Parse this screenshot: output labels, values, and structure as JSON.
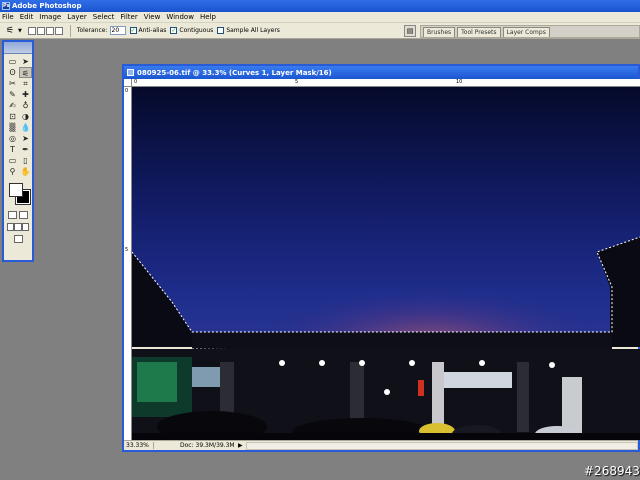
{
  "app": {
    "title": "Adobe Photoshop"
  },
  "menu": [
    "File",
    "Edit",
    "Image",
    "Layer",
    "Select",
    "Filter",
    "View",
    "Window",
    "Help"
  ],
  "options": {
    "tool_icon": "magic-wand-icon",
    "tolerance_label": "Tolerance:",
    "tolerance_value": "20",
    "anti_alias_label": "Anti-alias",
    "anti_alias_checked": true,
    "contiguous_label": "Contiguous",
    "contiguous_checked": true,
    "sample_all_label": "Sample All Layers",
    "sample_all_checked": false
  },
  "palette_well": {
    "tabs": [
      "Brushes",
      "Tool Presets",
      "Layer Comps"
    ]
  },
  "toolbox": {
    "tools": [
      "▭",
      "➤",
      "ʘ",
      "✂",
      "⌗",
      "✎",
      "✚",
      "✍",
      "♁",
      "⊡",
      "◑",
      "▒",
      "💧",
      "◎",
      "➤",
      "T",
      "✒",
      "▭",
      "▯",
      "⚲",
      "✋",
      "🔍"
    ]
  },
  "document": {
    "title": "080925-06.tif @ 33.3% (Curves 1, Layer Mask/16)",
    "ruler_h_marks": [
      "0",
      "5",
      "10"
    ],
    "ruler_v_marks": [
      "0",
      "5"
    ],
    "zoom": "33.33%",
    "doc_info": "Doc: 39.3M/39.3M"
  },
  "colors": {
    "titlebar": "#1a53cf",
    "sky_top": "#050a2a",
    "sky_mid": "#1a2a8a",
    "glow": "#b05a6a"
  },
  "watermark": "#268943"
}
